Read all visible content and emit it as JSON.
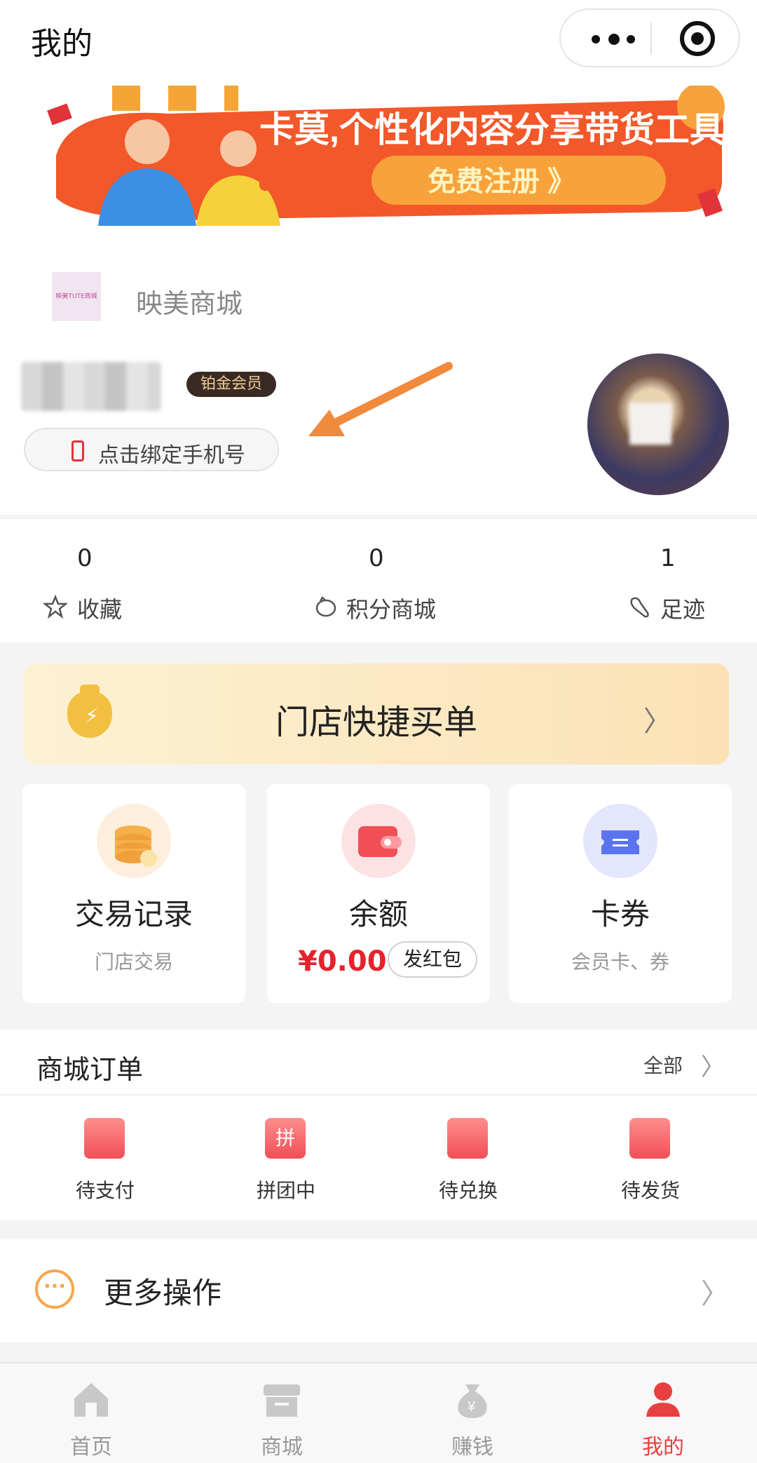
{
  "topbar": {
    "title": "我的"
  },
  "banner": {
    "headline": "卡莫,个性化内容分享带货工具",
    "cta": "免费注册 》"
  },
  "profile": {
    "shop_name": "映美商城",
    "shop_logo_text": "映美TUTE商城",
    "vip_badge": "铂金会员",
    "bind_phone": "点击绑定手机号"
  },
  "stats": [
    {
      "value": "0",
      "label": "收藏",
      "icon": "star-icon"
    },
    {
      "value": "0",
      "label": "积分商城",
      "icon": "piggy-icon"
    },
    {
      "value": "1",
      "label": "足迹",
      "icon": "footprint-icon"
    }
  ],
  "quickpay": {
    "label": "门店快捷买单"
  },
  "cards": {
    "trade": {
      "title": "交易记录",
      "sub": "门店交易"
    },
    "balance": {
      "title": "余额",
      "amount": "¥0.00",
      "redpack": "发红包"
    },
    "coupon": {
      "title": "卡券",
      "sub": "会员卡、券"
    }
  },
  "orders": {
    "title": "商城订单",
    "all": "全部",
    "items": [
      {
        "label": "待支付"
      },
      {
        "label": "拼团中",
        "glyph": "拼"
      },
      {
        "label": "待兑换"
      },
      {
        "label": "待发货"
      }
    ]
  },
  "more": {
    "label": "更多操作",
    "glyph": "···"
  },
  "tabbar": [
    {
      "label": "首页"
    },
    {
      "label": "商城"
    },
    {
      "label": "赚钱",
      "glyph": "¥"
    },
    {
      "label": "我的"
    }
  ],
  "colors": {
    "accent": "#e84040",
    "price": "#e4232d",
    "vip_bg": "#3a2a24",
    "vip_text": "#f1cf94"
  }
}
